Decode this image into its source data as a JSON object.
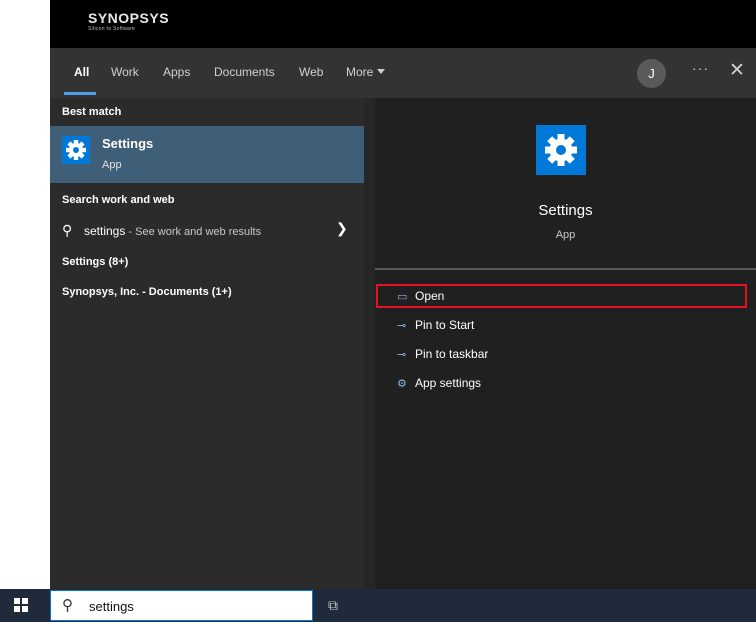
{
  "brand": {
    "name": "SYNOPSYS",
    "tagline": "Silicon to Software"
  },
  "tabs": [
    "All",
    "Work",
    "Apps",
    "Documents",
    "Web",
    "More"
  ],
  "account": {
    "initial": "J"
  },
  "header_icons": {
    "more": "ellipsis-icon",
    "close": "close-icon"
  },
  "left": {
    "best_match_heading": "Best match",
    "best_match": {
      "title": "Settings",
      "subtitle": "App",
      "icon": "gear-icon"
    },
    "search_heading": "Search work and web",
    "search_row": {
      "query": "settings",
      "hint": " - See work and web results"
    },
    "settings_group": "Settings (8+)",
    "documents_group": "Synopsys, Inc. - Documents (1+)"
  },
  "right": {
    "title": "Settings",
    "subtitle": "App",
    "actions": [
      {
        "label": "Open",
        "icon": "open-window-icon"
      },
      {
        "label": "Pin to Start",
        "icon": "pin-icon"
      },
      {
        "label": "Pin to taskbar",
        "icon": "pin-icon"
      },
      {
        "label": "App settings",
        "icon": "gear-icon"
      }
    ]
  },
  "taskbar": {
    "search_value": "settings"
  },
  "colors": {
    "accent": "#0078d7",
    "selection": "#3f5e78",
    "highlight": "#e81123"
  }
}
